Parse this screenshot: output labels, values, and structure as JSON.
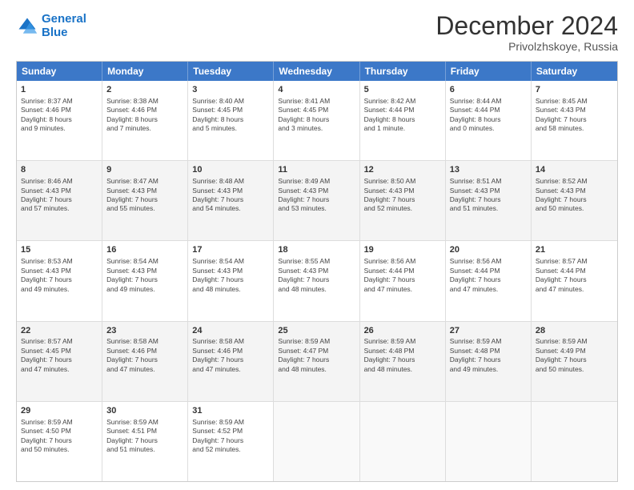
{
  "logo": {
    "line1": "General",
    "line2": "Blue"
  },
  "title": "December 2024",
  "subtitle": "Privolzhskoye, Russia",
  "headers": [
    "Sunday",
    "Monday",
    "Tuesday",
    "Wednesday",
    "Thursday",
    "Friday",
    "Saturday"
  ],
  "weeks": [
    [
      {
        "day": "1",
        "lines": [
          "Sunrise: 8:37 AM",
          "Sunset: 4:46 PM",
          "Daylight: 8 hours",
          "and 9 minutes."
        ]
      },
      {
        "day": "2",
        "lines": [
          "Sunrise: 8:38 AM",
          "Sunset: 4:46 PM",
          "Daylight: 8 hours",
          "and 7 minutes."
        ]
      },
      {
        "day": "3",
        "lines": [
          "Sunrise: 8:40 AM",
          "Sunset: 4:45 PM",
          "Daylight: 8 hours",
          "and 5 minutes."
        ]
      },
      {
        "day": "4",
        "lines": [
          "Sunrise: 8:41 AM",
          "Sunset: 4:45 PM",
          "Daylight: 8 hours",
          "and 3 minutes."
        ]
      },
      {
        "day": "5",
        "lines": [
          "Sunrise: 8:42 AM",
          "Sunset: 4:44 PM",
          "Daylight: 8 hours",
          "and 1 minute."
        ]
      },
      {
        "day": "6",
        "lines": [
          "Sunrise: 8:44 AM",
          "Sunset: 4:44 PM",
          "Daylight: 8 hours",
          "and 0 minutes."
        ]
      },
      {
        "day": "7",
        "lines": [
          "Sunrise: 8:45 AM",
          "Sunset: 4:43 PM",
          "Daylight: 7 hours",
          "and 58 minutes."
        ]
      }
    ],
    [
      {
        "day": "8",
        "lines": [
          "Sunrise: 8:46 AM",
          "Sunset: 4:43 PM",
          "Daylight: 7 hours",
          "and 57 minutes."
        ]
      },
      {
        "day": "9",
        "lines": [
          "Sunrise: 8:47 AM",
          "Sunset: 4:43 PM",
          "Daylight: 7 hours",
          "and 55 minutes."
        ]
      },
      {
        "day": "10",
        "lines": [
          "Sunrise: 8:48 AM",
          "Sunset: 4:43 PM",
          "Daylight: 7 hours",
          "and 54 minutes."
        ]
      },
      {
        "day": "11",
        "lines": [
          "Sunrise: 8:49 AM",
          "Sunset: 4:43 PM",
          "Daylight: 7 hours",
          "and 53 minutes."
        ]
      },
      {
        "day": "12",
        "lines": [
          "Sunrise: 8:50 AM",
          "Sunset: 4:43 PM",
          "Daylight: 7 hours",
          "and 52 minutes."
        ]
      },
      {
        "day": "13",
        "lines": [
          "Sunrise: 8:51 AM",
          "Sunset: 4:43 PM",
          "Daylight: 7 hours",
          "and 51 minutes."
        ]
      },
      {
        "day": "14",
        "lines": [
          "Sunrise: 8:52 AM",
          "Sunset: 4:43 PM",
          "Daylight: 7 hours",
          "and 50 minutes."
        ]
      }
    ],
    [
      {
        "day": "15",
        "lines": [
          "Sunrise: 8:53 AM",
          "Sunset: 4:43 PM",
          "Daylight: 7 hours",
          "and 49 minutes."
        ]
      },
      {
        "day": "16",
        "lines": [
          "Sunrise: 8:54 AM",
          "Sunset: 4:43 PM",
          "Daylight: 7 hours",
          "and 49 minutes."
        ]
      },
      {
        "day": "17",
        "lines": [
          "Sunrise: 8:54 AM",
          "Sunset: 4:43 PM",
          "Daylight: 7 hours",
          "and 48 minutes."
        ]
      },
      {
        "day": "18",
        "lines": [
          "Sunrise: 8:55 AM",
          "Sunset: 4:43 PM",
          "Daylight: 7 hours",
          "and 48 minutes."
        ]
      },
      {
        "day": "19",
        "lines": [
          "Sunrise: 8:56 AM",
          "Sunset: 4:44 PM",
          "Daylight: 7 hours",
          "and 47 minutes."
        ]
      },
      {
        "day": "20",
        "lines": [
          "Sunrise: 8:56 AM",
          "Sunset: 4:44 PM",
          "Daylight: 7 hours",
          "and 47 minutes."
        ]
      },
      {
        "day": "21",
        "lines": [
          "Sunrise: 8:57 AM",
          "Sunset: 4:44 PM",
          "Daylight: 7 hours",
          "and 47 minutes."
        ]
      }
    ],
    [
      {
        "day": "22",
        "lines": [
          "Sunrise: 8:57 AM",
          "Sunset: 4:45 PM",
          "Daylight: 7 hours",
          "and 47 minutes."
        ]
      },
      {
        "day": "23",
        "lines": [
          "Sunrise: 8:58 AM",
          "Sunset: 4:46 PM",
          "Daylight: 7 hours",
          "and 47 minutes."
        ]
      },
      {
        "day": "24",
        "lines": [
          "Sunrise: 8:58 AM",
          "Sunset: 4:46 PM",
          "Daylight: 7 hours",
          "and 47 minutes."
        ]
      },
      {
        "day": "25",
        "lines": [
          "Sunrise: 8:59 AM",
          "Sunset: 4:47 PM",
          "Daylight: 7 hours",
          "and 48 minutes."
        ]
      },
      {
        "day": "26",
        "lines": [
          "Sunrise: 8:59 AM",
          "Sunset: 4:48 PM",
          "Daylight: 7 hours",
          "and 48 minutes."
        ]
      },
      {
        "day": "27",
        "lines": [
          "Sunrise: 8:59 AM",
          "Sunset: 4:48 PM",
          "Daylight: 7 hours",
          "and 49 minutes."
        ]
      },
      {
        "day": "28",
        "lines": [
          "Sunrise: 8:59 AM",
          "Sunset: 4:49 PM",
          "Daylight: 7 hours",
          "and 50 minutes."
        ]
      }
    ],
    [
      {
        "day": "29",
        "lines": [
          "Sunrise: 8:59 AM",
          "Sunset: 4:50 PM",
          "Daylight: 7 hours",
          "and 50 minutes."
        ]
      },
      {
        "day": "30",
        "lines": [
          "Sunrise: 8:59 AM",
          "Sunset: 4:51 PM",
          "Daylight: 7 hours",
          "and 51 minutes."
        ]
      },
      {
        "day": "31",
        "lines": [
          "Sunrise: 8:59 AM",
          "Sunset: 4:52 PM",
          "Daylight: 7 hours",
          "and 52 minutes."
        ]
      },
      null,
      null,
      null,
      null
    ]
  ]
}
